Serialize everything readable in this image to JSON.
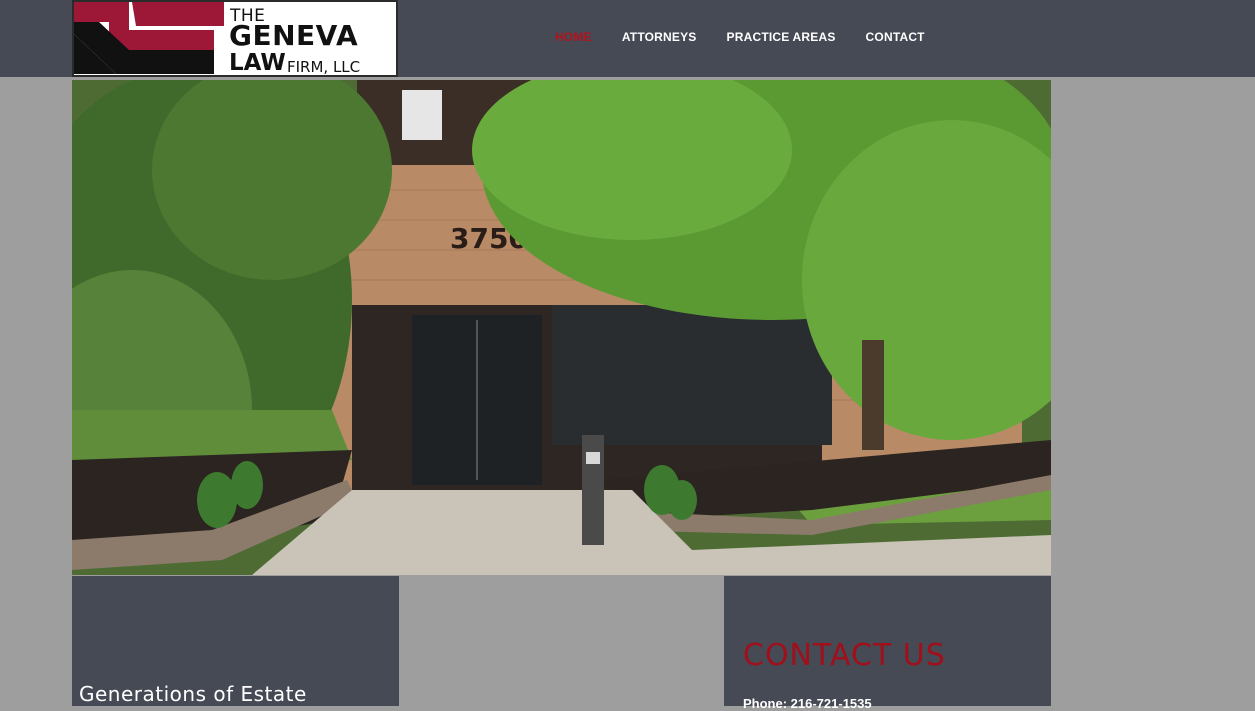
{
  "logo": {
    "line1": "THE",
    "line2": "GENEVA",
    "line3": "LAW",
    "line4": "FIRM, LLC"
  },
  "nav": {
    "items": [
      {
        "label": "HOME",
        "active": true
      },
      {
        "label": "ATTORNEYS",
        "active": false
      },
      {
        "label": "PRACTICE AREAS",
        "active": false
      },
      {
        "label": "CONTACT",
        "active": false
      }
    ]
  },
  "hero": {
    "building_number": "3750"
  },
  "left_panel": {
    "heading": "Generations of Estate"
  },
  "contact": {
    "heading": "CONTACT US",
    "phone": "Phone: 216-721-1535"
  },
  "colors": {
    "header_bg": "#464a55",
    "page_bg": "#9e9e9e",
    "accent_red": "#b3121c",
    "logo_red": "#9c1836"
  }
}
